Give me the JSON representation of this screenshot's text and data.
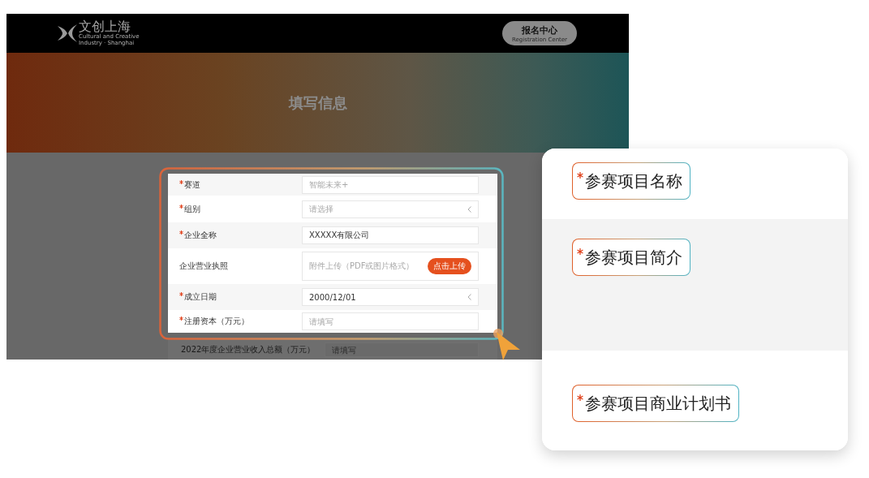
{
  "header": {
    "logo_text": "文创上海",
    "logo_subtitle_line1": "Cultural and Creative",
    "logo_subtitle_line2": "Industry · Shanghai",
    "button": {
      "label": "报名中心",
      "sublabel": "Registration Center"
    }
  },
  "banner": {
    "title": "填写信息"
  },
  "form": {
    "rows": [
      {
        "label": "赛道",
        "required": true,
        "kind": "text",
        "placeholder": "智能未来+"
      },
      {
        "label": "组别",
        "required": true,
        "kind": "select",
        "placeholder": "请选择"
      },
      {
        "label": "企业全称",
        "required": true,
        "kind": "text",
        "value": "XXXXX有限公司"
      },
      {
        "label": "企业营业执照",
        "required": false,
        "kind": "upload",
        "placeholder": "附件上传（PDF或图片格式）",
        "button": "点击上传"
      },
      {
        "label": "成立日期",
        "required": true,
        "kind": "select",
        "value": "2000/12/01"
      },
      {
        "label": "注册资本（万元）",
        "required": true,
        "kind": "text",
        "placeholder": "请填写"
      }
    ],
    "dimmed_row": {
      "label": "2022年度企业营业收入总额（万元）",
      "placeholder": "请填写"
    }
  },
  "callout": {
    "fields": [
      {
        "label": "参赛项目名称",
        "required": true
      },
      {
        "label": "参赛项目简介",
        "required": true
      },
      {
        "label": "参赛项目商业计划书",
        "required": true
      }
    ]
  }
}
